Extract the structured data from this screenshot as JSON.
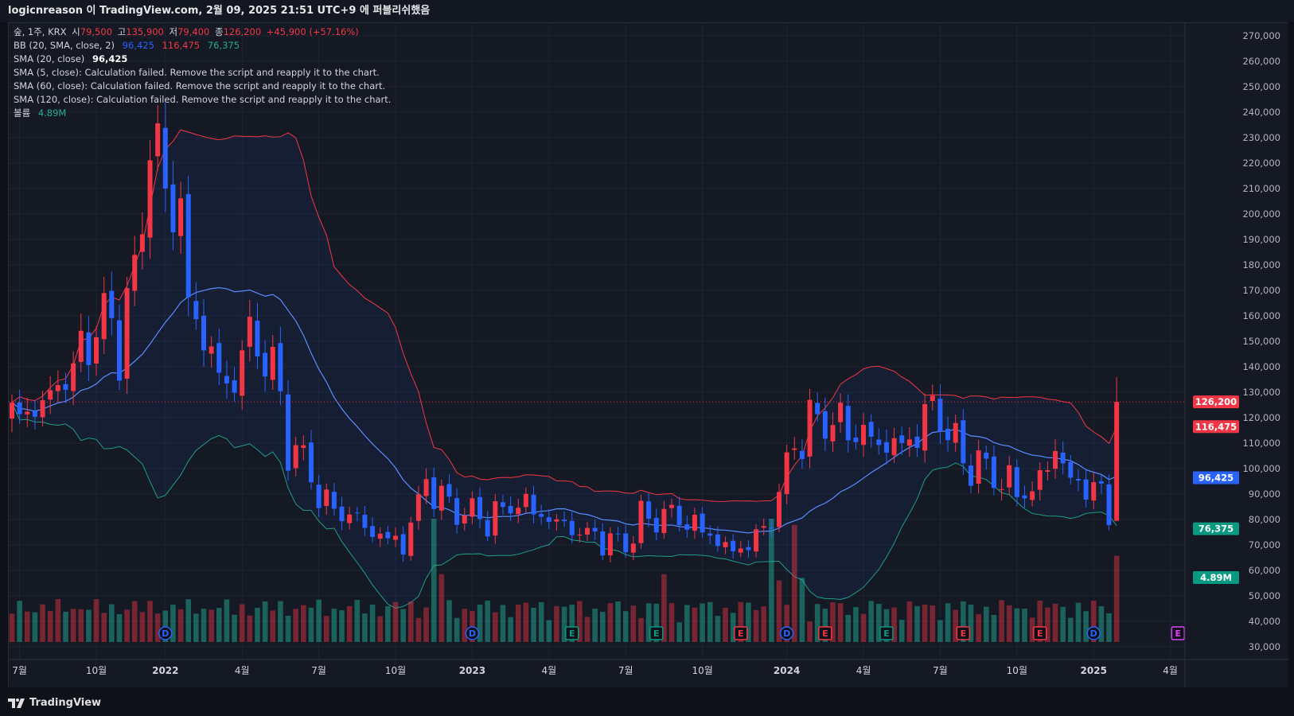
{
  "header": {
    "caption": "logicnreason 이 TradingView.com, 2월 09, 2025 21:51 UTC+9 에 퍼블리쉬했음"
  },
  "legend": {
    "symbol": "숲, 1주, KRX",
    "o_label": "시",
    "o_value": "79,500",
    "h_label": "고",
    "h_value": "135,900",
    "l_label": "저",
    "l_value": "79,400",
    "c_label": "종",
    "c_value": "126,200",
    "change": "+45,900 (+57.16%)",
    "bb_label": "BB (20, SMA, close, 2)",
    "bb_basis": "96,425",
    "bb_upper": "116,475",
    "bb_lower": "76,375",
    "sma20_label": "SMA (20, close)",
    "sma20_value": "96,425",
    "sma5_error": "SMA (5, close): Calculation failed. Remove the script and reapply it to the chart.",
    "sma60_error": "SMA (60, close): Calculation failed. Remove the script and reapply it to the chart.",
    "sma120_error": "SMA (120, close): Calculation failed. Remove the script and reapply it to the chart.",
    "volume_label": "볼륨",
    "volume_value": "4.89M"
  },
  "price_scale": {
    "ticks": [
      "270,000",
      "260,000",
      "250,000",
      "240,000",
      "230,000",
      "220,000",
      "210,000",
      "200,000",
      "190,000",
      "180,000",
      "170,000",
      "160,000",
      "150,000",
      "140,000",
      "130,000",
      "120,000",
      "110,000",
      "100,000",
      "90,000",
      "80,000",
      "70,000",
      "60,000",
      "50,000",
      "40,000",
      "30,000"
    ],
    "tick_values": [
      270000,
      260000,
      250000,
      240000,
      230000,
      220000,
      210000,
      200000,
      190000,
      180000,
      170000,
      160000,
      150000,
      140000,
      130000,
      120000,
      110000,
      100000,
      90000,
      80000,
      70000,
      60000,
      50000,
      40000,
      30000
    ],
    "labels": [
      {
        "text": "126,200",
        "value": 126200,
        "color": "#f23645",
        "text_color": "#ffffff"
      },
      {
        "text": "116,475",
        "value": 116475,
        "color": "#f23645",
        "text_color": "#ffffff"
      },
      {
        "text": "96,425",
        "value": 96425,
        "color": "#ffffff",
        "text_color": "#000000"
      },
      {
        "text": "96,425",
        "value": 96425,
        "color": "#2962ff",
        "text_color": "#ffffff"
      },
      {
        "text": "76,375",
        "value": 76375,
        "color": "#089981",
        "text_color": "#ffffff"
      },
      {
        "text": "4.89M",
        "value": 57200,
        "color": "#089981",
        "text_color": "#ffffff"
      }
    ]
  },
  "time_scale": {
    "labels": [
      "7월",
      "10월",
      "2022",
      "4월",
      "7월",
      "10월",
      "2023",
      "4월",
      "7월",
      "10월",
      "2024",
      "4월",
      "7월",
      "10월",
      "2025",
      "4월"
    ],
    "bold": [
      false,
      false,
      true,
      false,
      false,
      false,
      true,
      false,
      false,
      false,
      true,
      false,
      false,
      false,
      true,
      false
    ]
  },
  "events": [
    {
      "letter": "D",
      "week": 20,
      "color": "#2962ff"
    },
    {
      "letter": "D",
      "week": 60,
      "color": "#2962ff"
    },
    {
      "letter": "E",
      "week": 73,
      "color": "#089981"
    },
    {
      "letter": "E",
      "week": 84,
      "color": "#089981"
    },
    {
      "letter": "E",
      "week": 95,
      "color": "#f23645"
    },
    {
      "letter": "D",
      "week": 101,
      "color": "#2962ff"
    },
    {
      "letter": "E",
      "week": 106,
      "color": "#f23645"
    },
    {
      "letter": "E",
      "week": 114,
      "color": "#089981"
    },
    {
      "letter": "E",
      "week": 124,
      "color": "#f23645"
    },
    {
      "letter": "E",
      "week": 134,
      "color": "#f23645"
    },
    {
      "letter": "D",
      "week": 141,
      "color": "#2962ff"
    },
    {
      "letter": "E",
      "week": 152,
      "color": "#e040fb"
    }
  ],
  "brand": "TradingView",
  "colors": {
    "up": "#f23645",
    "down": "#2962ff",
    "upper": "#f23645",
    "basis": "#5b8cff",
    "lower": "#1e9e86"
  },
  "chart_data": {
    "type": "candlestick",
    "interval": "1W",
    "last": {
      "open": 79500,
      "high": 135900,
      "low": 79400,
      "close": 126200,
      "volume": "4.89M"
    },
    "anchor_closes": [
      [
        0,
        120000
      ],
      [
        4,
        125000
      ],
      [
        8,
        140000
      ],
      [
        12,
        160000
      ],
      [
        14,
        150000
      ],
      [
        16,
        175000
      ],
      [
        18,
        230000
      ],
      [
        20,
        210000
      ],
      [
        22,
        200000
      ],
      [
        23,
        165000
      ],
      [
        26,
        145000
      ],
      [
        28,
        130000
      ],
      [
        31,
        152000
      ],
      [
        34,
        140000
      ],
      [
        36,
        110000
      ],
      [
        38,
        103000
      ],
      [
        41,
        85000
      ],
      [
        44,
        82000
      ],
      [
        47,
        75000
      ],
      [
        51,
        70000
      ],
      [
        54,
        95000
      ],
      [
        57,
        85000
      ],
      [
        62,
        80000
      ],
      [
        66,
        87000
      ],
      [
        70,
        80000
      ],
      [
        75,
        74000
      ],
      [
        80,
        70000
      ],
      [
        82,
        80000
      ],
      [
        86,
        82000
      ],
      [
        90,
        76000
      ],
      [
        94,
        67000
      ],
      [
        98,
        75000
      ],
      [
        100,
        90000
      ],
      [
        102,
        110000
      ],
      [
        105,
        120000
      ],
      [
        108,
        117000
      ],
      [
        111,
        113000
      ],
      [
        114,
        109000
      ],
      [
        117,
        110000
      ],
      [
        120,
        125000
      ],
      [
        122,
        115000
      ],
      [
        124,
        103000
      ],
      [
        127,
        100000
      ],
      [
        130,
        93000
      ],
      [
        133,
        90000
      ],
      [
        136,
        108000
      ],
      [
        138,
        95000
      ],
      [
        140,
        93000
      ],
      [
        142,
        91000
      ],
      [
        143,
        79500
      ],
      [
        144,
        126200
      ]
    ],
    "bb_last": {
      "upper": 116475,
      "basis": 96425,
      "lower": 76375
    }
  }
}
